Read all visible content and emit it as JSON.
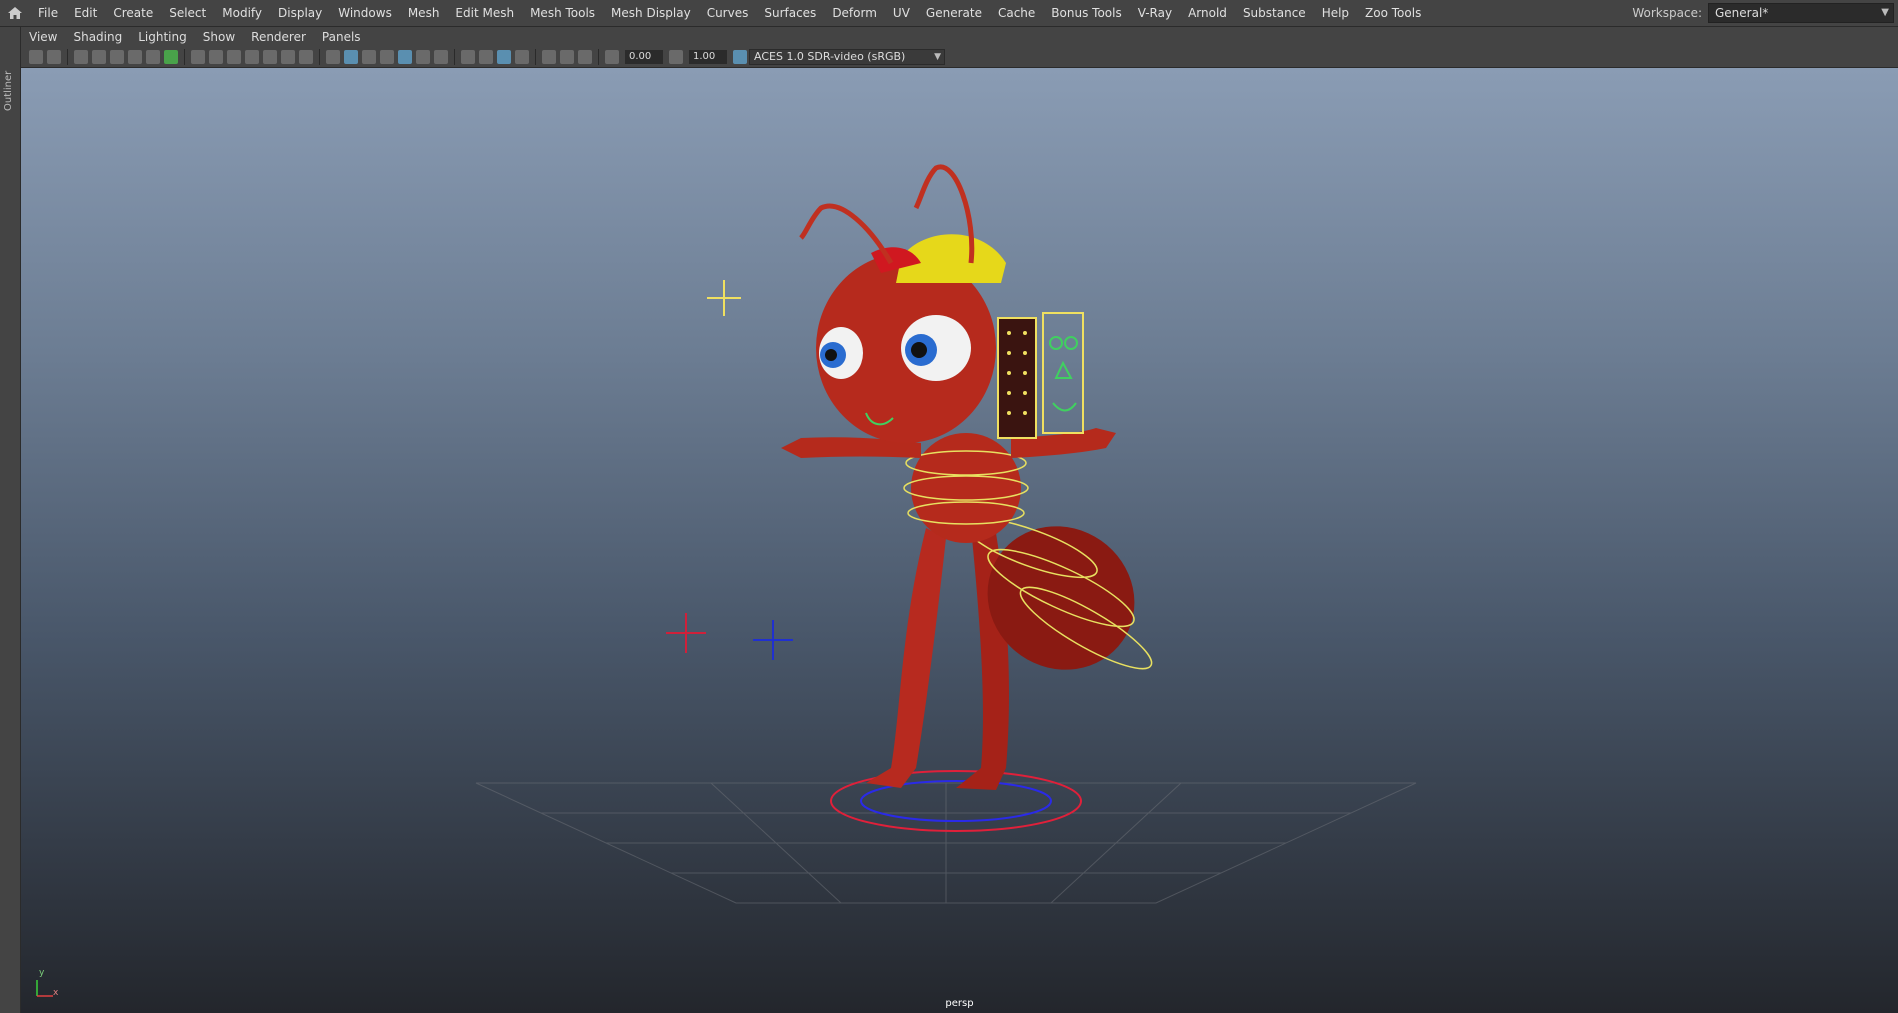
{
  "menu": [
    "File",
    "Edit",
    "Create",
    "Select",
    "Modify",
    "Display",
    "Windows",
    "Mesh",
    "Edit Mesh",
    "Mesh Tools",
    "Mesh Display",
    "Curves",
    "Surfaces",
    "Deform",
    "UV",
    "Generate",
    "Cache",
    "Bonus Tools",
    "V-Ray",
    "Arnold",
    "Substance",
    "Help",
    "Zoo Tools"
  ],
  "workspace": {
    "label": "Workspace:",
    "value": "General*"
  },
  "outliner_label": "Outliner",
  "panel_menu": [
    "View",
    "Shading",
    "Lighting",
    "Show",
    "Renderer",
    "Panels"
  ],
  "toolbar": {
    "exposure": "0.00",
    "gamma": "1.00",
    "colorspace": "ACES 1.0 SDR-video (sRGB)"
  },
  "viewport": {
    "camera": "persp",
    "axis_y": "y",
    "axis_x": "x"
  }
}
